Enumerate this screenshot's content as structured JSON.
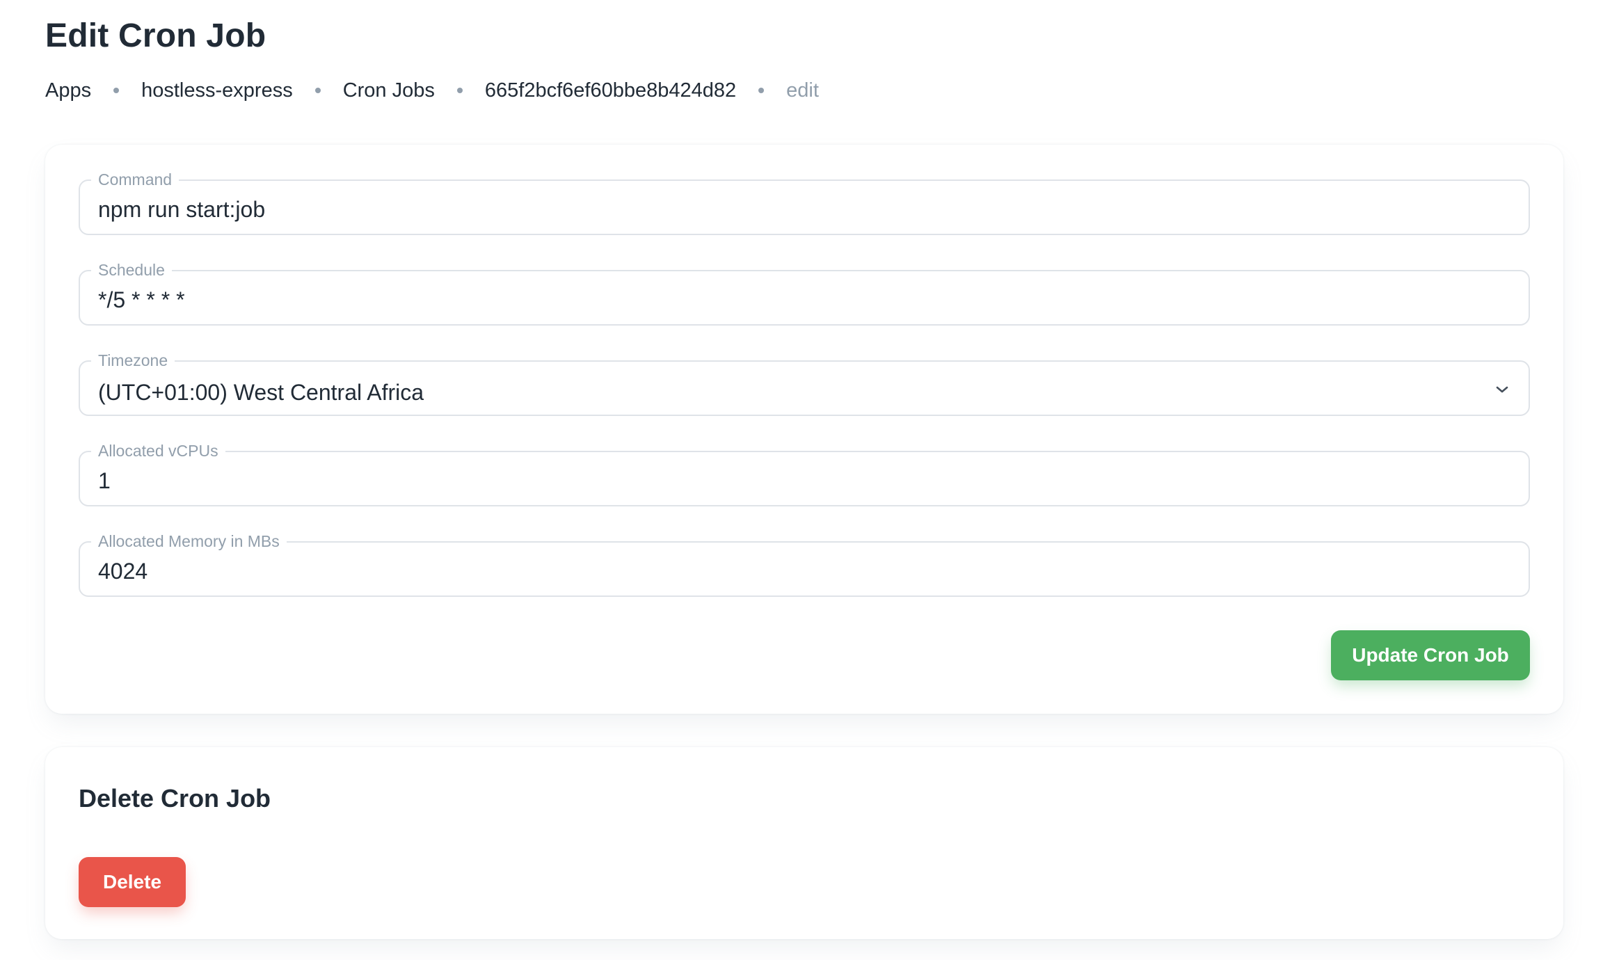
{
  "page": {
    "title": "Edit Cron Job"
  },
  "breadcrumb": {
    "items": [
      "Apps",
      "hostless-express",
      "Cron Jobs",
      "665f2bcf6ef60bbe8b424d82"
    ],
    "current": "edit"
  },
  "form": {
    "command": {
      "label": "Command",
      "value": "npm run start:job"
    },
    "schedule": {
      "label": "Schedule",
      "value": "*/5 * * * *"
    },
    "timezone": {
      "label": "Timezone",
      "value": "(UTC+01:00) West Central Africa",
      "icon": "chevron-down-icon"
    },
    "vcpus": {
      "label": "Allocated vCPUs",
      "value": "1"
    },
    "memory": {
      "label": "Allocated Memory in MBs",
      "value": "4024"
    },
    "submit_label": "Update Cron Job"
  },
  "delete_section": {
    "title": "Delete Cron Job",
    "button_label": "Delete"
  },
  "colors": {
    "text": "#212b36",
    "muted": "#919eab",
    "border": "#dfe3e8",
    "success": "#4caf5f",
    "danger": "#e9554a"
  }
}
